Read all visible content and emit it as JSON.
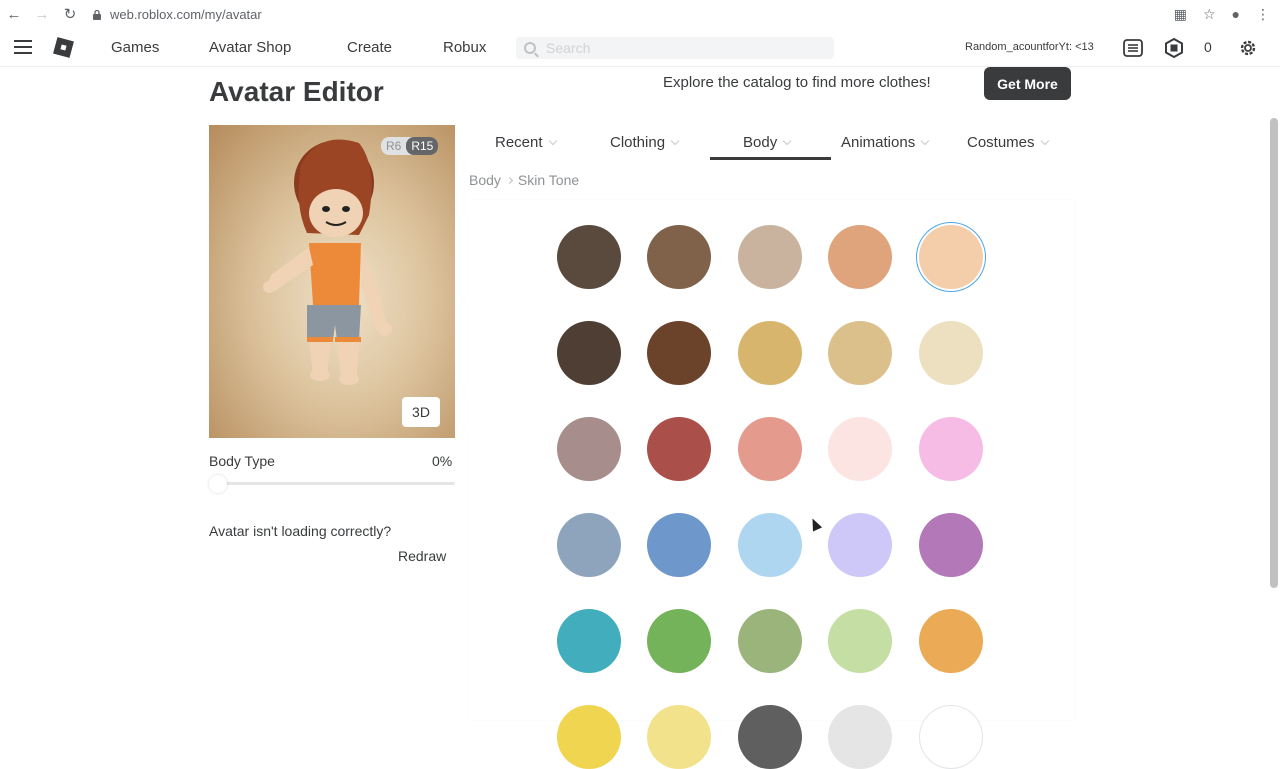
{
  "browser": {
    "url": "web.roblox.com/my/avatar"
  },
  "header": {
    "nav": [
      "Games",
      "Avatar Shop",
      "Create",
      "Robux"
    ],
    "search_placeholder": "Search",
    "username": "Random_acountforYt: <13",
    "robux": "0"
  },
  "page": {
    "title": "Avatar Editor",
    "explore_text": "Explore the catalog to find more clothes!",
    "get_more_label": "Get More"
  },
  "preview": {
    "rig_options": [
      "R6",
      "R15"
    ],
    "rig_selected": "R15",
    "view_3d_label": "3D",
    "body_type_label": "Body Type",
    "body_type_value": "0%",
    "body_type_level": 0,
    "loading_question": "Avatar isn't loading correctly?",
    "redraw_label": "Redraw"
  },
  "tabs": [
    {
      "label": "Recent"
    },
    {
      "label": "Clothing"
    },
    {
      "label": "Body",
      "active": true
    },
    {
      "label": "Animations"
    },
    {
      "label": "Costumes"
    }
  ],
  "breadcrumb": [
    "Body",
    "Skin Tone"
  ],
  "skin_tones": [
    "#5a4a3d",
    "#7f6249",
    "#c9b29e",
    "#e0a47c",
    "#f4ceab",
    "#4e3e33",
    "#6b432a",
    "#d8b56d",
    "#dcc08c",
    "#ece0c1",
    "#a78d8b",
    "#ab4f4b",
    "#e49a8c",
    "#fbe4e2",
    "#f6bce6",
    "#8ea4bd",
    "#6e97cb",
    "#afd6f0",
    "#cdc8f7",
    "#b378b8",
    "#42adbd",
    "#74b35a",
    "#9ab47b",
    "#c4dea4",
    "#ebaa55",
    "#f0d551",
    "#f3e28c",
    "#5f5f5f",
    "#e5e5e5",
    "#ffffff"
  ],
  "selected_skin_tone": 4,
  "colors": {
    "text": "#393b3d",
    "selection_ring": "#4ba8e6",
    "button_dark": "#393b3d"
  }
}
